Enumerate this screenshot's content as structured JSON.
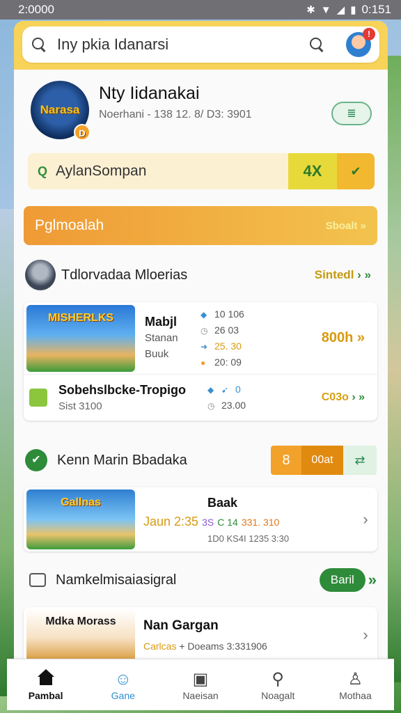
{
  "status": {
    "time_left": "2:0000",
    "time_right": "0:151"
  },
  "search": {
    "text": "Iny pkia Idanarsi"
  },
  "profile": {
    "name": "Nty Iidanakai",
    "meta": "Noerhani - 138 12. 8/ D3: 3901",
    "button": "≣",
    "logo_badge": "D"
  },
  "promo": {
    "text": "AylanSompan",
    "value": "4X"
  },
  "banner": {
    "title": "Pglmoalah",
    "link": "Sboalt"
  },
  "section1": {
    "title": "Tdlorvadaa Mloerias",
    "link": "Sintedl"
  },
  "list1": {
    "row1": {
      "thumb": "MISHERLKS",
      "t1": "Mabjl",
      "t2": "Stanan",
      "t3": "Buuk",
      "stats": [
        "10 106",
        "26 03",
        "25. 30",
        "20: 09"
      ],
      "price": "800h"
    },
    "row2": {
      "title": "Sobehslbcke-Tropigo",
      "sub": "Sist 3100",
      "stats": [
        "0",
        "23.00"
      ],
      "price": "C03o"
    }
  },
  "section2": {
    "title": "Kenn Marin Bbadaka",
    "tag1": "8",
    "tag2": "00at"
  },
  "list2": {
    "thumb": "Gallnas",
    "title": "Baak",
    "price": "Jaun 2:35",
    "c2": "3S",
    "c3": "C 14",
    "c4": "331. 310",
    "line3": "1D0 KS4I 1235 3:30"
  },
  "section3": {
    "title": "Namkelmisaiasigral",
    "pill": "Baril"
  },
  "list3": {
    "thumb": "Mdka Morass",
    "title": "Nan Gargan",
    "meta_a": "Carlcas",
    "meta_b": "+ Doeams",
    "meta_c": "3:331906"
  },
  "nav": [
    {
      "label": "Pambal"
    },
    {
      "label": "Gane"
    },
    {
      "label": "Naeisan"
    },
    {
      "label": "Noagalt"
    },
    {
      "label": "Mothaa"
    }
  ]
}
